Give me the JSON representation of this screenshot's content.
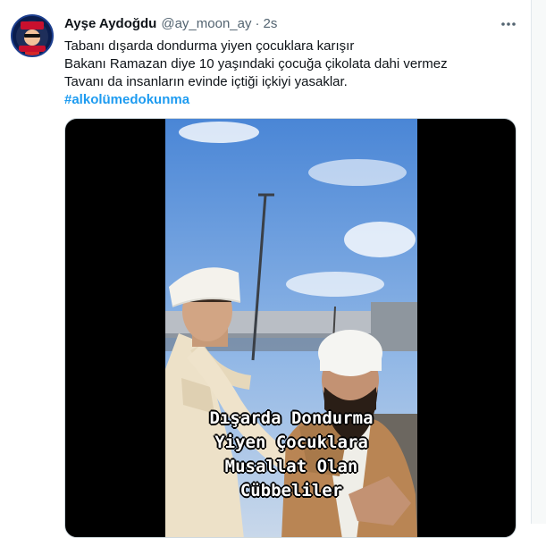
{
  "tweet": {
    "author": {
      "display_name": "Ayşe Aydoğdu",
      "handle": "@ay_moon_ay",
      "time": "2s",
      "avatar_text_top": "KANAL",
      "avatar_text_bottom": "İSTANBUL"
    },
    "text_lines": [
      "Tabanı dışarda dondurma yiyen çocuklara karışır",
      "Bakanı Ramazan diye 10 yaşındaki çocuğa çikolata dahi vermez",
      "Tavanı da insanların evinde içtiği içkiyi yasaklar."
    ],
    "hashtag": "#alkolümedokunma",
    "media": {
      "type": "video",
      "caption_lines": [
        "Dışarda Dondurma",
        "Yiyen Çocuklara",
        "Musallat Olan",
        "Cübbeliler"
      ]
    }
  },
  "icons": {
    "more": "more-horizontal-icon"
  },
  "colors": {
    "link": "#1d9bf0",
    "text": "#0f1419",
    "secondary": "#536471",
    "border": "#e1e8ed"
  }
}
